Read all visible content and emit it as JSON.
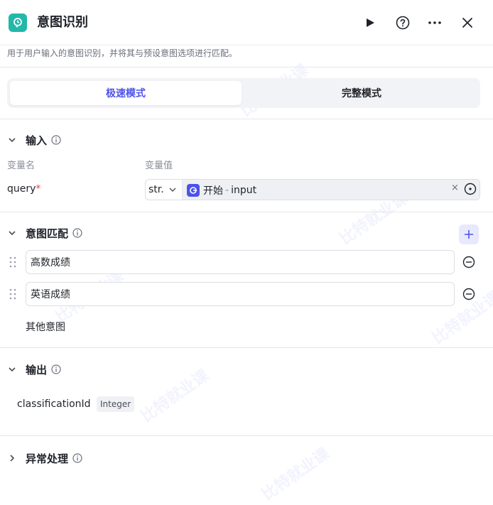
{
  "header": {
    "title": "意图识别",
    "icon": "intent-node-icon",
    "actions": [
      "run-icon",
      "help-icon",
      "more-icon",
      "close-icon"
    ],
    "description": "用于用户输入的意图识别，并将其与预设意图选项进行匹配。"
  },
  "mode_tabs": {
    "fast": "极速模式",
    "full": "完整模式",
    "active": "fast"
  },
  "input_section": {
    "title": "输入",
    "col_name": "变量名",
    "col_value": "变量值",
    "var_name": "query",
    "required_mark": "*",
    "type": "str.",
    "ref_node": "开始",
    "ref_sep": "-",
    "ref_var": "input",
    "clear": "×"
  },
  "intent_section": {
    "title": "意图匹配",
    "intents": [
      "高数成绩",
      "英语成绩"
    ],
    "other": "其他意图"
  },
  "output_section": {
    "title": "输出",
    "name": "classificationId",
    "type": "Integer"
  },
  "exception_section": {
    "title": "异常处理"
  },
  "watermark": "比特就业课",
  "colors": {
    "accent": "#4d53e8",
    "node_icon_bg": "#23b8a9",
    "required": "#e5484d"
  }
}
